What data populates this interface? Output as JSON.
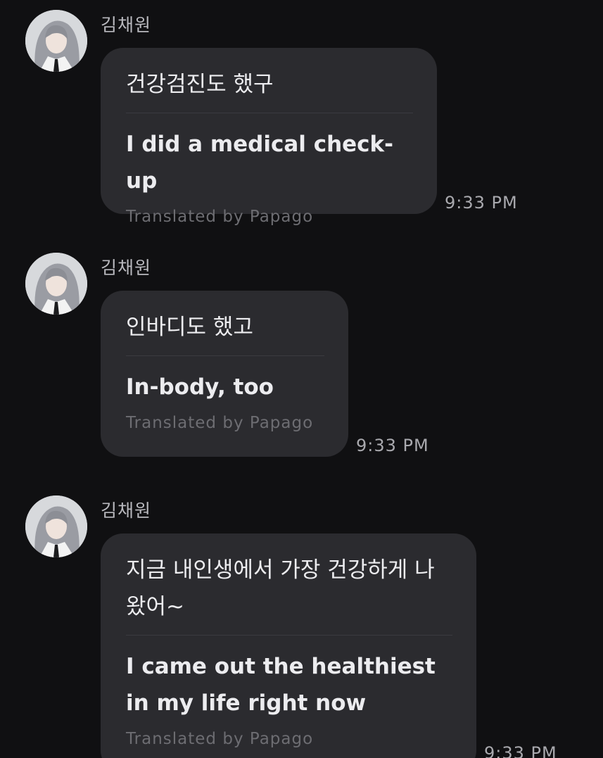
{
  "messages": [
    {
      "sender": "김채원",
      "original": "건강검진도 했구",
      "translated": "I did a medical check-up",
      "credit": "Translated by Papago",
      "time": "9:33 PM"
    },
    {
      "sender": "김채원",
      "original": "인바디도 했고",
      "translated": "In-body, too",
      "credit": "Translated by Papago",
      "time": "9:33 PM"
    },
    {
      "sender": "김채원",
      "original": "지금 내인생에서 가장 건강하게 나 왔어~",
      "translated": "I came out the healthiest in my life right now",
      "credit": "Translated by Papago",
      "time": "9:33 PM"
    }
  ]
}
